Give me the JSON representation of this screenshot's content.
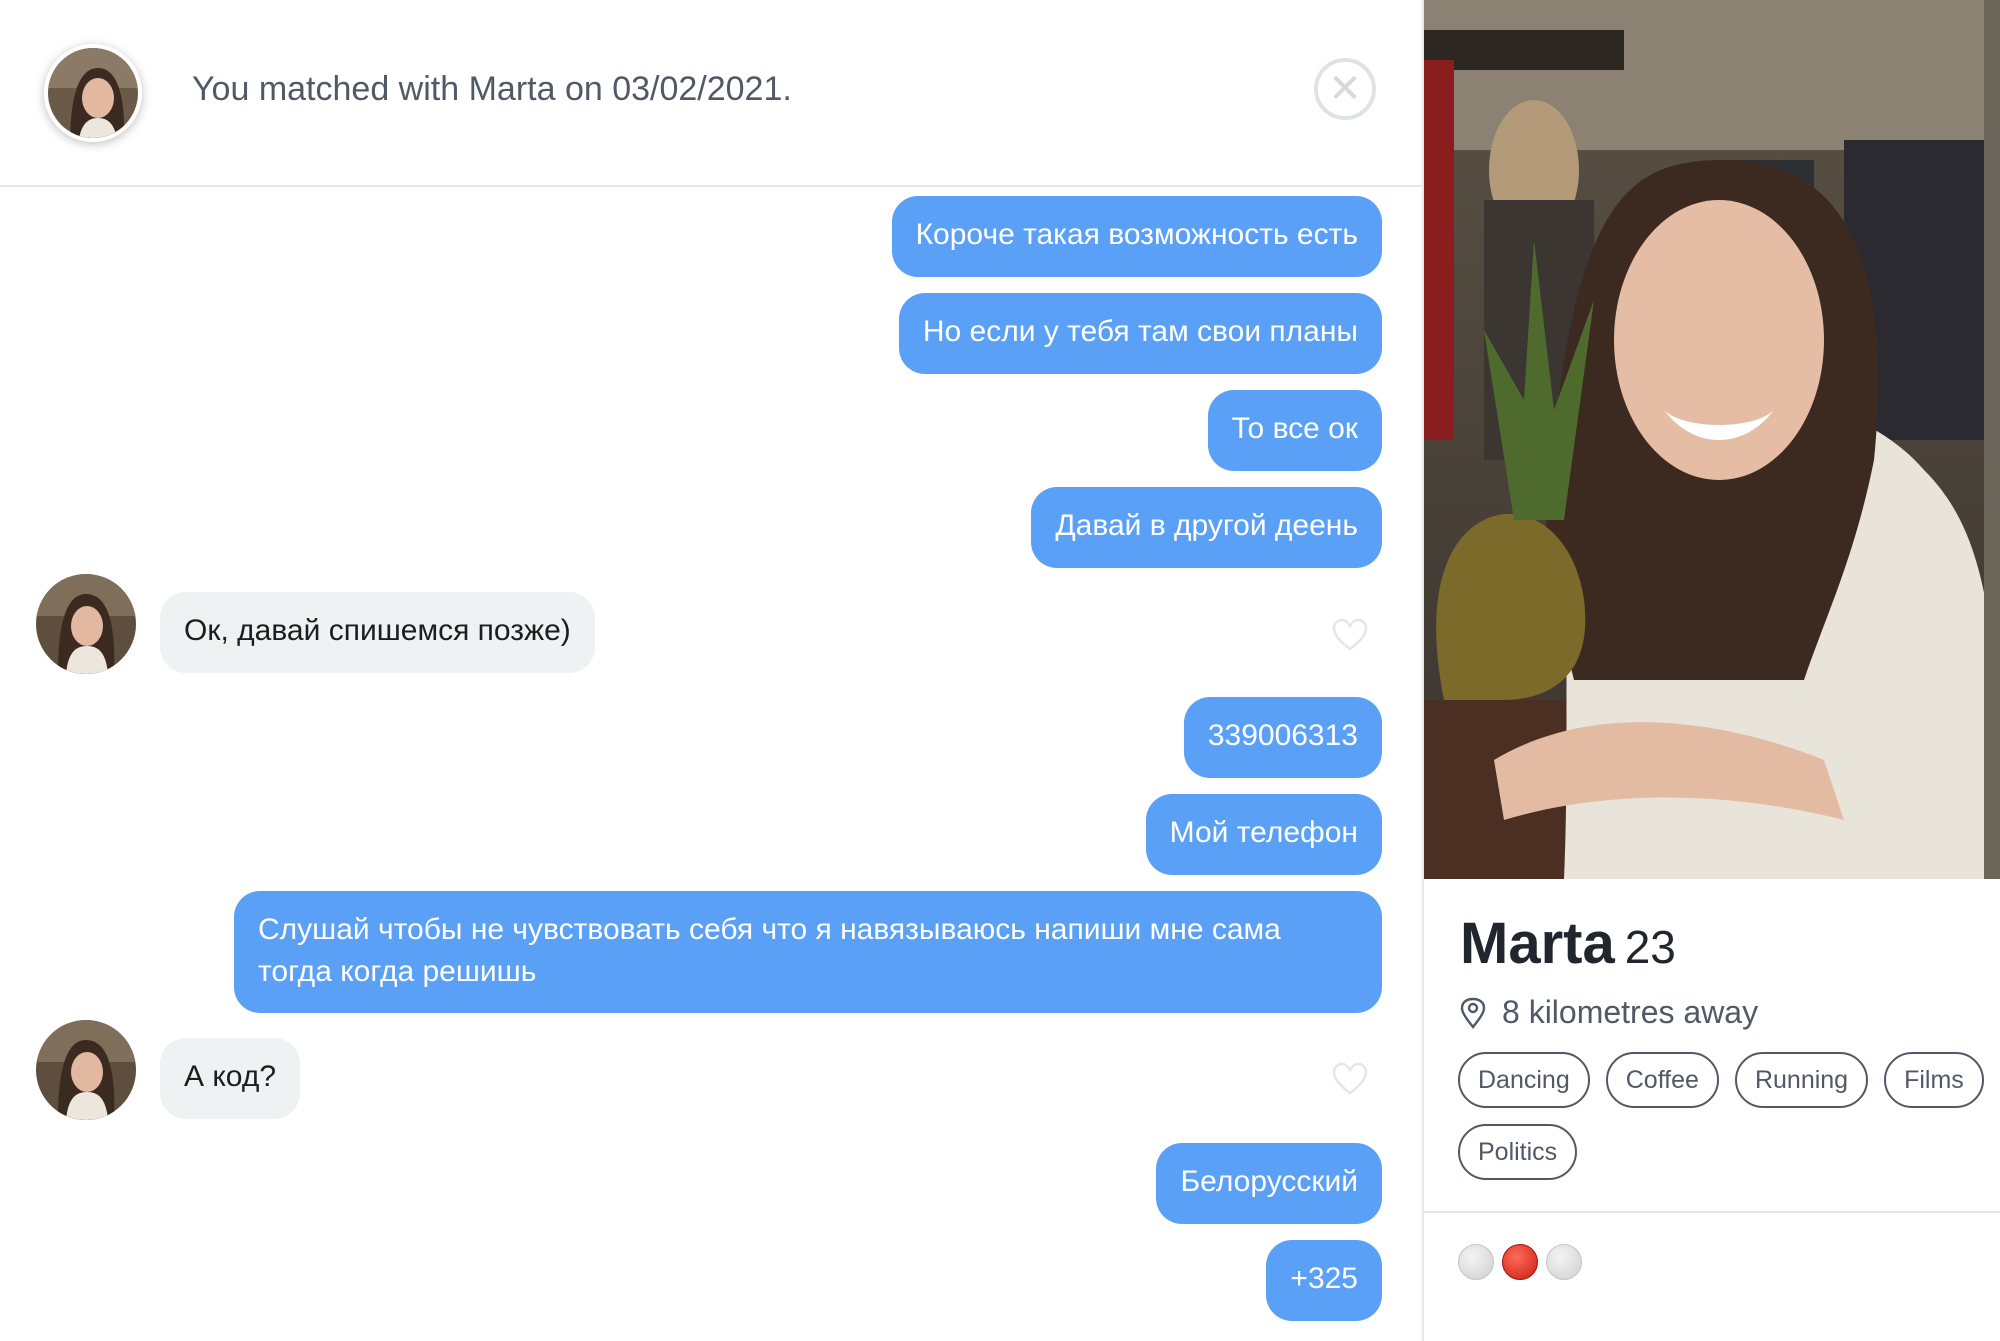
{
  "header": {
    "match_text": "You matched with Marta on 03/02/2021.",
    "close_symbol": "✕"
  },
  "messages": [
    {
      "direction": "out",
      "text": "Короче такая возможность есть"
    },
    {
      "direction": "out",
      "text": "Но если у тебя там свои планы"
    },
    {
      "direction": "out",
      "text": "То все ок"
    },
    {
      "direction": "out",
      "text": "Давай в другой деень"
    },
    {
      "direction": "in",
      "text": "Ок, давай спишемся позже)"
    },
    {
      "direction": "out",
      "text": "339006313"
    },
    {
      "direction": "out",
      "text": "Мой телефон"
    },
    {
      "direction": "out",
      "text": "Слушай чтобы не чувствовать себя что я навязываюсь напиши мне сама тогда когда решишь"
    },
    {
      "direction": "in",
      "text": "А код?"
    },
    {
      "direction": "out",
      "text": "Белорусский"
    },
    {
      "direction": "out",
      "text": "+325"
    }
  ],
  "profile": {
    "name": "Marta",
    "age": "23",
    "distance": "8 kilometres away",
    "interests": [
      "Dancing",
      "Coffee",
      "Running",
      "Films",
      "Politics"
    ],
    "photo_count": 3,
    "active_photo_index": 1
  },
  "colors": {
    "outgoing_bubble": "#5aa0f6",
    "incoming_bubble": "#f0f1f3",
    "active_dot": "#d42a1c"
  },
  "icons": [
    "close-icon",
    "heart-icon",
    "location-pin-icon"
  ]
}
